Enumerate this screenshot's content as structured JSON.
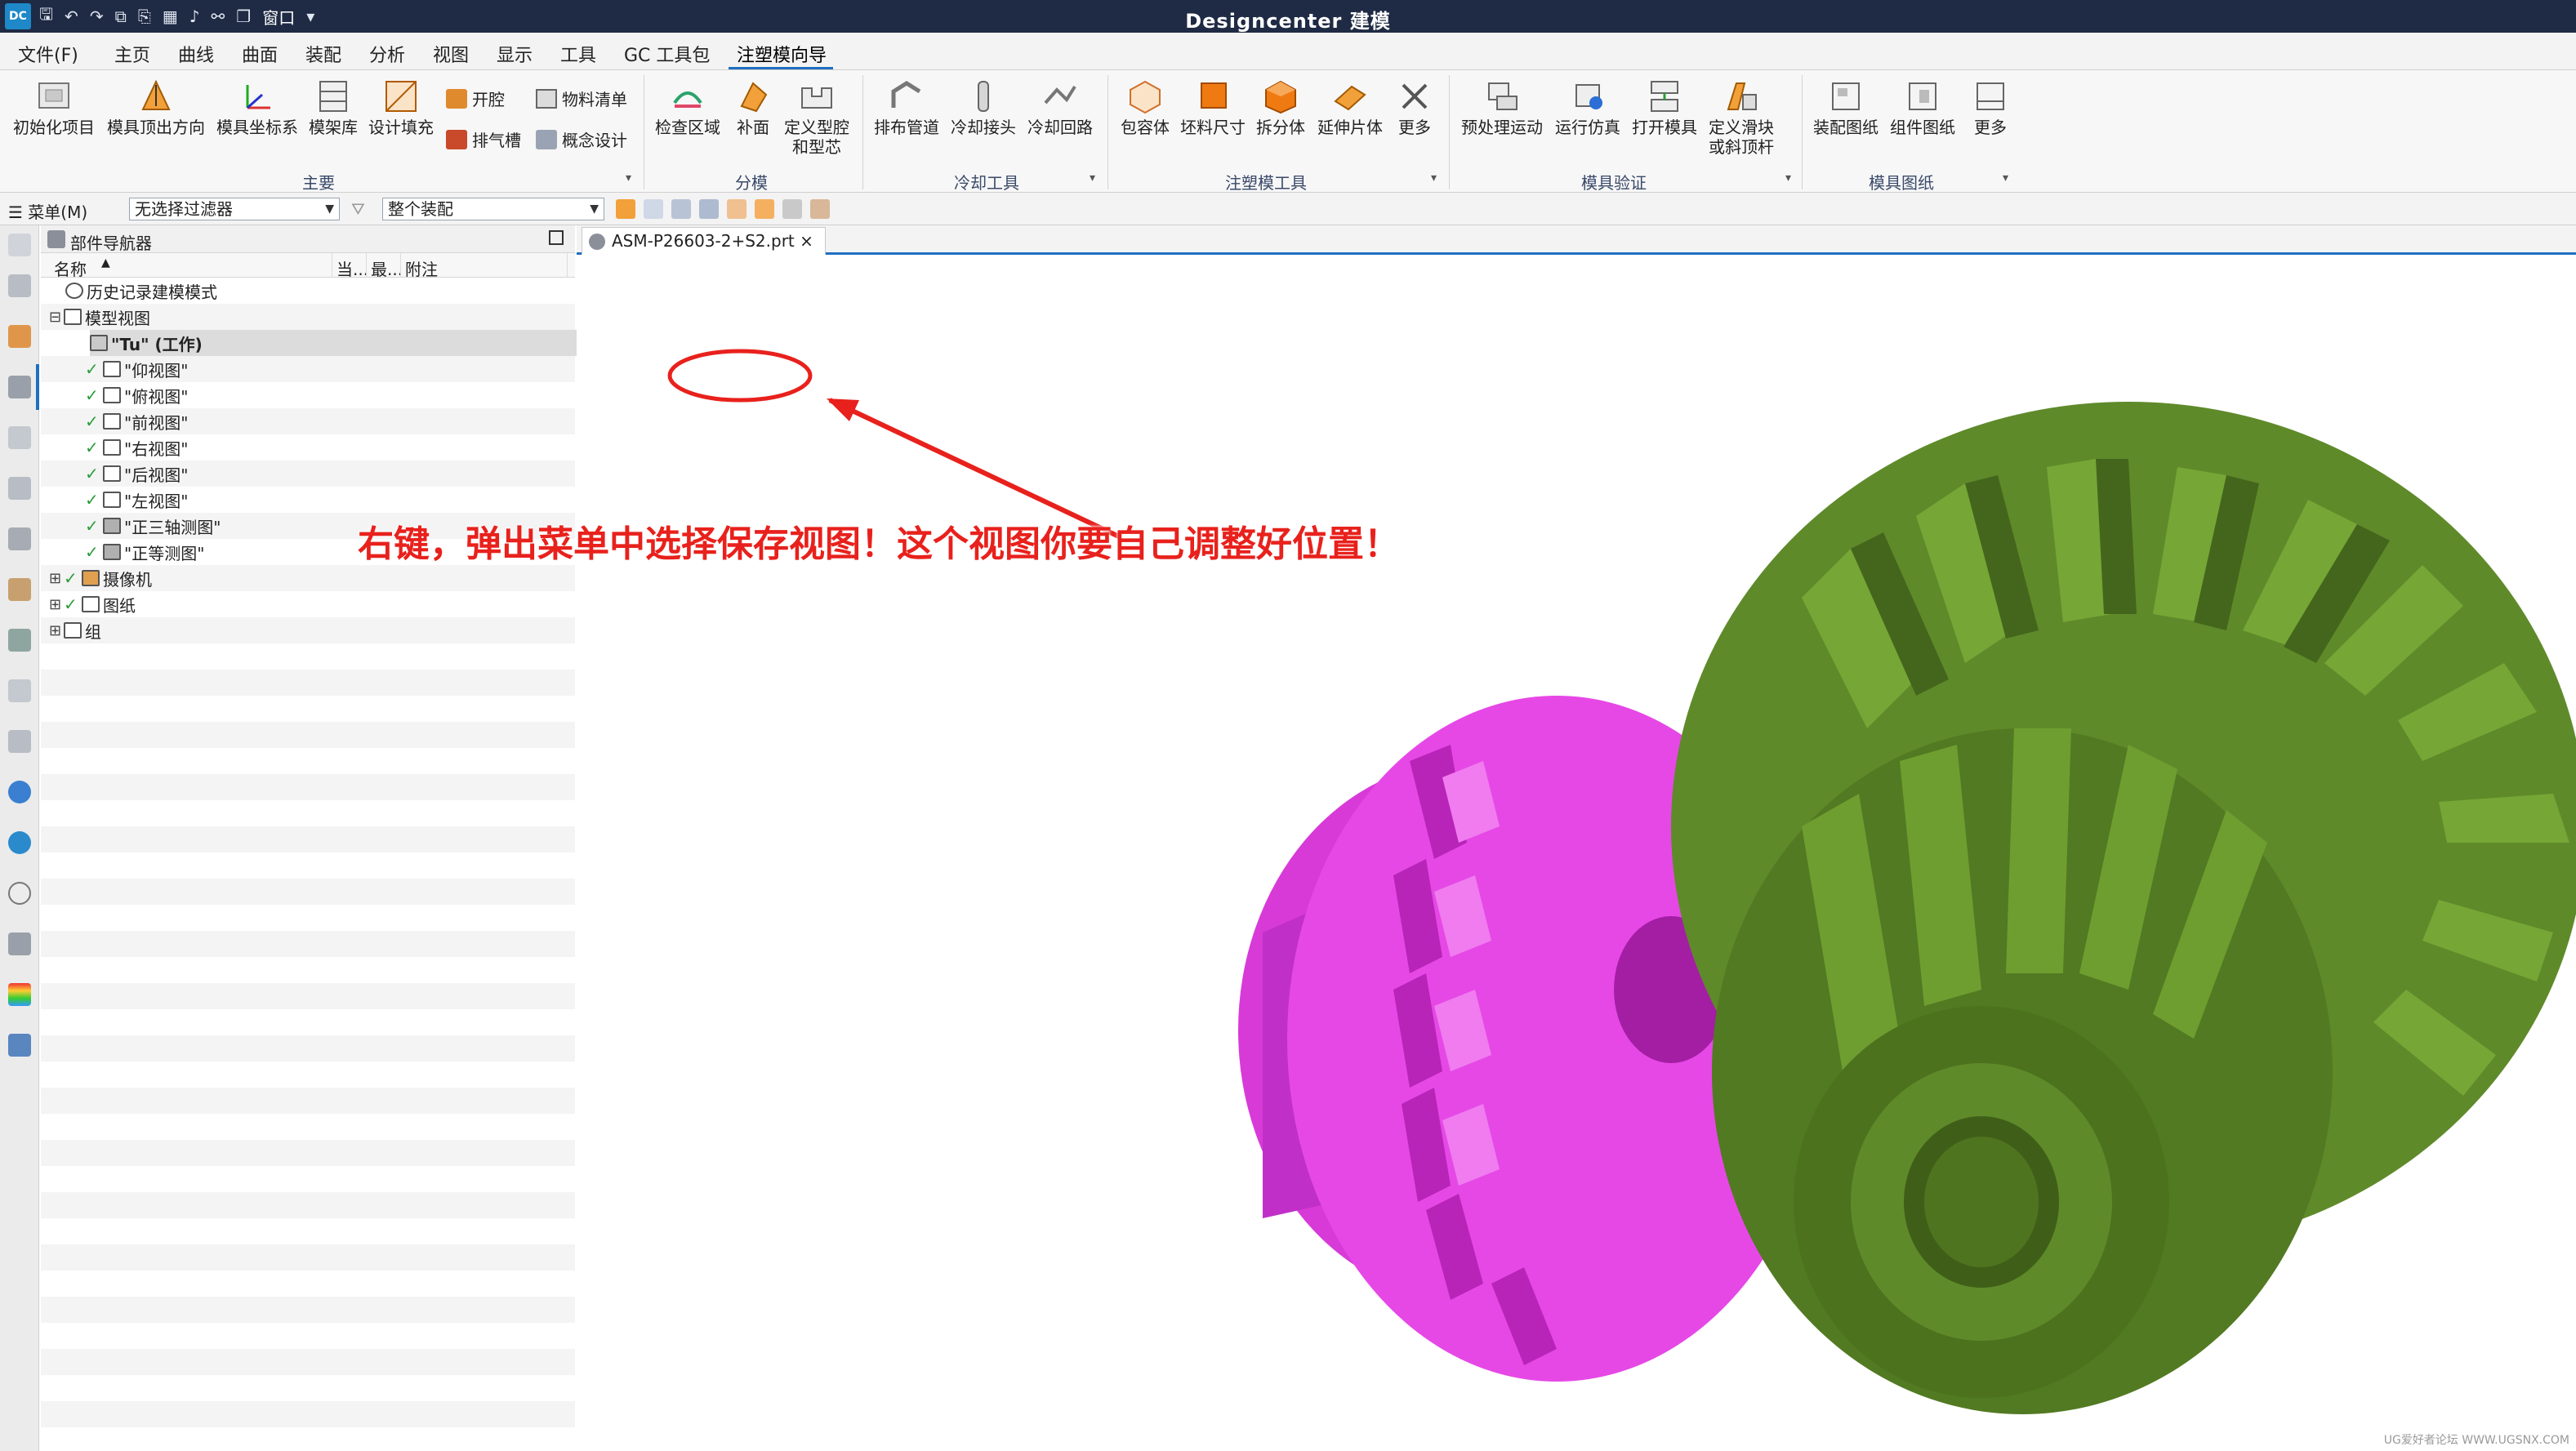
{
  "app": {
    "logo_text": "DC",
    "title": "Designcenter 建模",
    "window_menu": "窗口"
  },
  "menubar": [
    "文件(F)",
    "主页",
    "曲线",
    "曲面",
    "装配",
    "分析",
    "视图",
    "显示",
    "工具",
    "GC 工具包",
    "注塑模向导"
  ],
  "ribbon": {
    "group1": {
      "label": "主要",
      "buttons": [
        "初始化项目",
        "模具顶出方向",
        "模具坐标系",
        "模架库",
        "设计填充"
      ],
      "small": [
        "开腔",
        "排气槽",
        "物料清单",
        "概念设计"
      ]
    },
    "group2": {
      "label": "分模",
      "buttons": [
        "检查区域",
        "补面",
        "定义型腔",
        "和型芯"
      ]
    },
    "group3": {
      "label": "冷却工具",
      "buttons": [
        "排布管道",
        "冷却接头",
        "冷却回路"
      ]
    },
    "group4": {
      "label": "注塑模工具",
      "buttons": [
        "包容体",
        "坯料尺寸",
        "拆分体",
        "延伸片体",
        "更多"
      ]
    },
    "group5": {
      "label": "模具验证",
      "buttons": [
        "预处理运动",
        "运行仿真",
        "打开模具",
        "定义滑块",
        "或斜顶杆"
      ]
    },
    "group6": {
      "label": "模具图纸",
      "buttons": [
        "装配图纸",
        "组件图纸",
        "更多"
      ]
    }
  },
  "filterbar": {
    "menu": "☰ 菜单(M)",
    "filter": "无选择过滤器",
    "scope": "整个装配"
  },
  "navigator": {
    "title": "部件导航器",
    "columns": [
      "名称",
      "当...",
      "最...",
      "附注"
    ],
    "rows": [
      {
        "label": "历史记录建模模式"
      },
      {
        "label": "模型视图"
      },
      {
        "label": "\"Tu\" (工作)"
      },
      {
        "label": "\"仰视图\""
      },
      {
        "label": "\"俯视图\""
      },
      {
        "label": "\"前视图\""
      },
      {
        "label": "\"右视图\""
      },
      {
        "label": "\"后视图\""
      },
      {
        "label": "\"左视图\""
      },
      {
        "label": "\"正三轴测图\""
      },
      {
        "label": "\"正等测图\""
      },
      {
        "label": "摄像机"
      },
      {
        "label": "图纸"
      },
      {
        "label": "组"
      }
    ]
  },
  "viewport": {
    "tab": "ASM-P26603-2+S2.prt ×"
  },
  "annotation": "右键，弹出菜单中选择保存视图！这个视图你要自己调整好位置！",
  "watermark": "UG爱好者论坛 WWW.UGSNX.COM",
  "colors": {
    "title_bg": "#1f2a44",
    "accent": "#1f6fc0",
    "annotation": "#e8211c",
    "gear_green": "#5f8a2a",
    "gear_magenta": "#e040e0"
  },
  "icons": [
    "save-icon",
    "undo-icon",
    "redo-icon",
    "gear-settings-icon",
    "check-icon",
    "plus-expand-icon"
  ]
}
